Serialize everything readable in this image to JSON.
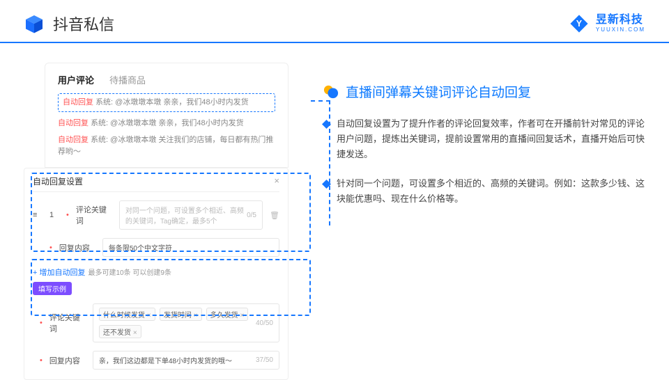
{
  "header": {
    "title": "抖音私信",
    "brand_cn": "昱新科技",
    "brand_en": "YUUXIN.COM"
  },
  "panel_top": {
    "tabs": [
      "用户评论",
      "待播商品"
    ],
    "active_tab": 0,
    "replies": [
      {
        "tag": "自动回复",
        "text": "系统: @冰墩墩本墩 亲亲，我们48小时内发货"
      },
      {
        "tag": "自动回复",
        "text": "系统: @冰墩墩本墩 亲亲，我们48小时内发货"
      },
      {
        "tag": "自动回复",
        "text": "系统: @冰墩墩本墩 关注我们的店铺，每日都有热门推荐哟～"
      }
    ]
  },
  "panel_bottom": {
    "title": "自动回复设置",
    "row_num": "1",
    "keyword_label": "评论关键词",
    "keyword_placeholder": "对同一个问题，可设置多个相近、高频的关键词，Tag确定，最多5个",
    "keyword_counter": "0/5",
    "content_label": "回复内容",
    "content_placeholder": "每条限50个中文字符",
    "add_text": "+ 增加自动回复",
    "add_hint": "最多可建10条 可以创建9条",
    "example_badge": "填写示例",
    "ex_keyword_label": "评论关键词",
    "ex_chips": [
      "什么时候发货",
      "发货时间",
      "多久发货",
      "还不发货"
    ],
    "ex_counter": "40/50",
    "ex_content_label": "回复内容",
    "ex_content_value": "亲，我们这边都是下单48小时内发货的哦～",
    "ex_content_counter": "37/50"
  },
  "right": {
    "section_title": "直播间弹幕关键词评论自动回复",
    "bullets": [
      "自动回复设置为了提升作者的评论回复效率，作者可在开播前针对常见的评论用户问题，提炼出关键词，提前设置常用的直播间回复话术，直播开始后可快捷发送。",
      "针对同一个问题，可设置多个相近的、高频的关键词。例如：这款多少钱、这块能优惠吗、现在什么价格等。"
    ]
  }
}
